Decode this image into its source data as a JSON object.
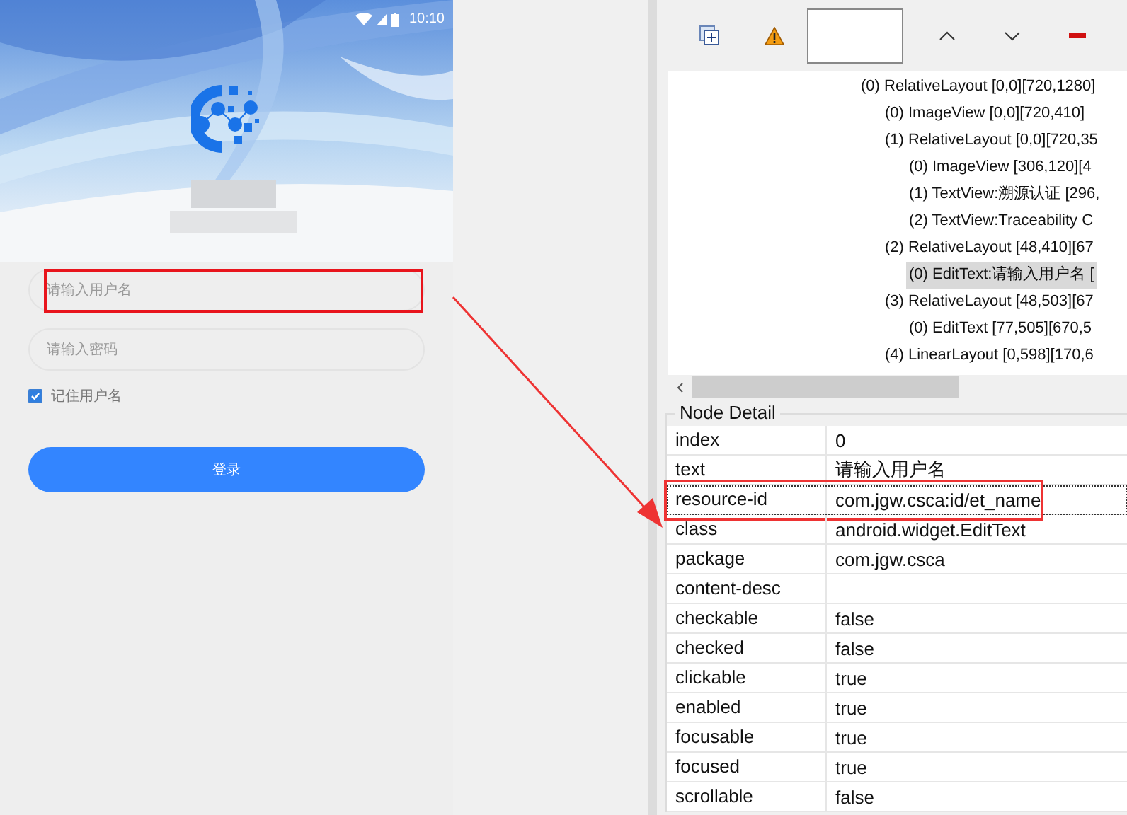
{
  "phone": {
    "status_bar": {
      "time": "10:10"
    },
    "username_field": {
      "placeholder": "请输入用户名",
      "highlighted": true
    },
    "password_field": {
      "placeholder": "请输入密码"
    },
    "remember": {
      "label": "记住用户名",
      "checked": true
    },
    "login_button": {
      "label": "登录"
    }
  },
  "tree": {
    "nodes": [
      {
        "label": "(0) RelativeLayout [0,0][720,1280]",
        "selected": false,
        "children": [
          {
            "label": "(0) ImageView [0,0][720,410]",
            "selected": false
          },
          {
            "label": "(1) RelativeLayout [0,0][720,35",
            "selected": false,
            "children": [
              {
                "label": "(0) ImageView [306,120][4",
                "selected": false
              },
              {
                "label": "(1) TextView:溯源认证 [296,",
                "selected": false
              },
              {
                "label": "(2) TextView:Traceability C",
                "selected": false
              }
            ]
          },
          {
            "label": "(2) RelativeLayout [48,410][67",
            "selected": false,
            "children": [
              {
                "label": "(0) EditText:请输入用户名 [",
                "selected": true
              }
            ]
          },
          {
            "label": "(3) RelativeLayout [48,503][67",
            "selected": false,
            "children": [
              {
                "label": "(0) EditText [77,505][670,5",
                "selected": false
              }
            ]
          },
          {
            "label": "(4) LinearLayout [0,598][170,6",
            "selected": false
          }
        ]
      }
    ]
  },
  "node_detail": {
    "title": "Node Detail",
    "rows": [
      {
        "key": "index",
        "value": "0",
        "selected": false,
        "highlighted": false
      },
      {
        "key": "text",
        "value": "请输入用户名",
        "selected": false,
        "highlighted": false
      },
      {
        "key": "resource-id",
        "value": "com.jgw.csca:id/et_name",
        "selected": true,
        "highlighted": true
      },
      {
        "key": "class",
        "value": "android.widget.EditText",
        "selected": false,
        "highlighted": false
      },
      {
        "key": "package",
        "value": "com.jgw.csca",
        "selected": false,
        "highlighted": false
      },
      {
        "key": "content-desc",
        "selected": false,
        "highlighted": false
      },
      {
        "key": "checkable",
        "value": "false",
        "selected": false,
        "highlighted": false
      },
      {
        "key": "checked",
        "value": "false",
        "selected": false,
        "highlighted": false
      },
      {
        "key": "clickable",
        "value": "true",
        "selected": false,
        "highlighted": false
      },
      {
        "key": "enabled",
        "value": "true",
        "selected": false,
        "highlighted": false
      },
      {
        "key": "focusable",
        "value": "true",
        "selected": false,
        "highlighted": false
      },
      {
        "key": "focused",
        "value": "true",
        "selected": false,
        "highlighted": false
      },
      {
        "key": "scrollable",
        "value": "false",
        "selected": false,
        "highlighted": false
      }
    ]
  }
}
